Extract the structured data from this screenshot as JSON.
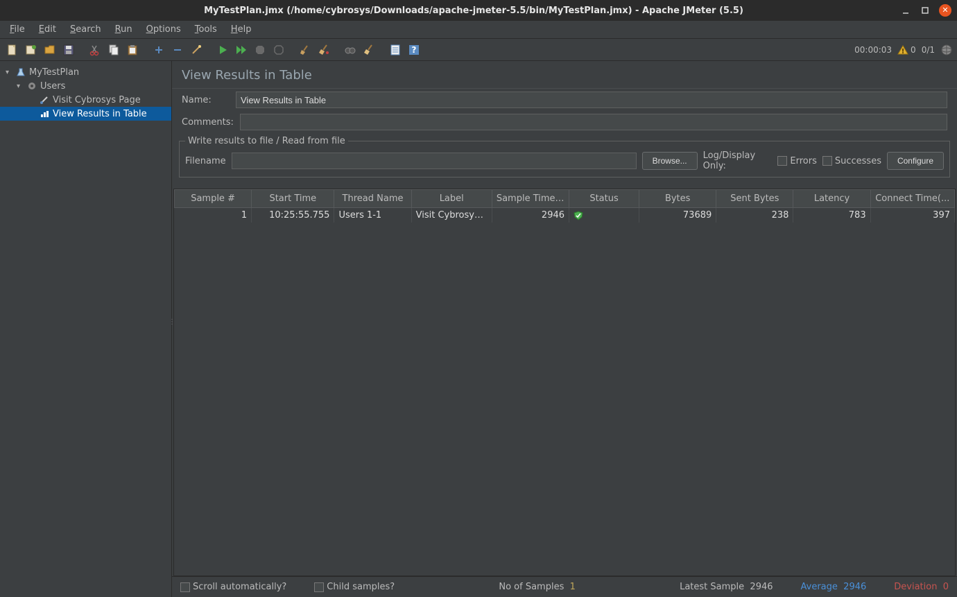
{
  "window": {
    "title": "MyTestPlan.jmx (/home/cybrosys/Downloads/apache-jmeter-5.5/bin/MyTestPlan.jmx) - Apache JMeter (5.5)"
  },
  "menu": {
    "items": [
      "File",
      "Edit",
      "Search",
      "Run",
      "Options",
      "Tools",
      "Help"
    ]
  },
  "toolbar_right": {
    "timer": "00:00:03",
    "warn_count": "0",
    "threads": "0/1"
  },
  "tree": {
    "root": {
      "label": "MyTestPlan"
    },
    "group": {
      "label": "Users"
    },
    "sampler": {
      "label": "Visit Cybrosys Page"
    },
    "listener": {
      "label": "View Results in Table"
    }
  },
  "panel": {
    "heading": "View Results in Table",
    "name_label": "Name:",
    "name_value": "View Results in Table",
    "comments_label": "Comments:",
    "comments_value": "",
    "file_legend": "Write results to file / Read from file",
    "filename_label": "Filename",
    "filename_value": "",
    "browse_btn": "Browse...",
    "logdisplay_label": "Log/Display Only:",
    "errors_label": "Errors",
    "successes_label": "Successes",
    "configure_btn": "Configure"
  },
  "table": {
    "headers": [
      "Sample #",
      "Start Time",
      "Thread Name",
      "Label",
      "Sample Time(...",
      "Status",
      "Bytes",
      "Sent Bytes",
      "Latency",
      "Connect Time(..."
    ],
    "row1": {
      "sample": "1",
      "start": "10:25:55.755",
      "thread": "Users 1-1",
      "label": "Visit Cybrosys ...",
      "sample_time": "2946",
      "bytes": "73689",
      "sent_bytes": "238",
      "latency": "783",
      "connect": "397"
    }
  },
  "status": {
    "scroll_label": "Scroll automatically?",
    "child_label": "Child samples?",
    "no_samples_label": "No of Samples",
    "no_samples_val": "1",
    "latest_label": "Latest Sample",
    "latest_val": "2946",
    "avg_label": "Average",
    "avg_val": "2946",
    "dev_label": "Deviation",
    "dev_val": "0"
  }
}
